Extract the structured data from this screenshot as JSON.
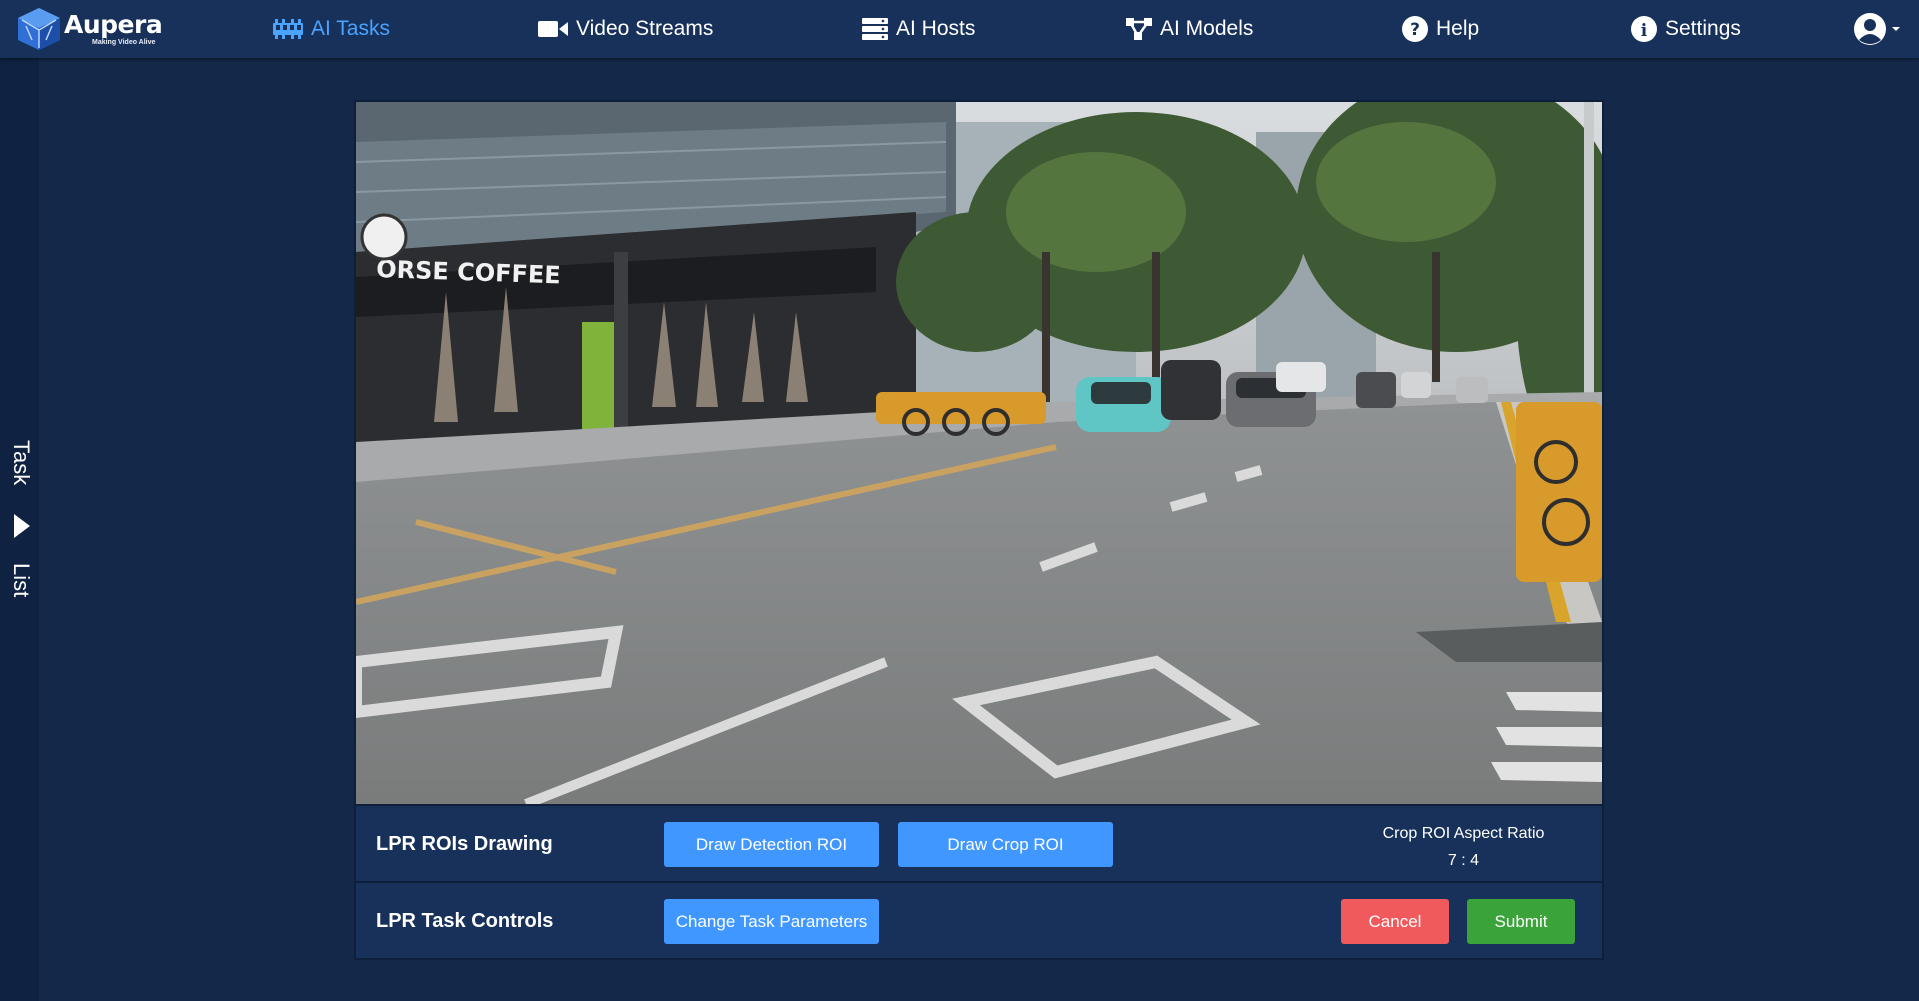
{
  "app": {
    "logo_name": "Aupera",
    "logo_tagline": "Making Video Alive"
  },
  "nav": {
    "ai_tasks": "AI Tasks",
    "video_streams": "Video Streams",
    "ai_hosts": "AI Hosts",
    "ai_models": "AI Models",
    "help": "Help",
    "settings": "Settings"
  },
  "side_tab": {
    "word1": "Task",
    "word2": "List"
  },
  "video": {
    "description_icons": [
      "storefront",
      "street",
      "cars",
      "bikes"
    ],
    "sign_text": "ORSE COFFEE"
  },
  "roi_row": {
    "label": "LPR ROIs Drawing",
    "draw_detection": "Draw Detection ROI",
    "draw_crop": "Draw Crop ROI",
    "ratio_label": "Crop ROI Aspect Ratio",
    "ratio_value": "7 : 4"
  },
  "controls_row": {
    "label": "LPR Task Controls",
    "change_params": "Change Task Parameters",
    "cancel": "Cancel",
    "submit": "Submit"
  },
  "colors": {
    "page_bg": "#14284a",
    "topbar_bg": "#17315a",
    "active_nav": "#4aa3ff",
    "primary_button": "#3f97ff",
    "cancel_button": "#f05a5d",
    "submit_button": "#3aa33a"
  }
}
